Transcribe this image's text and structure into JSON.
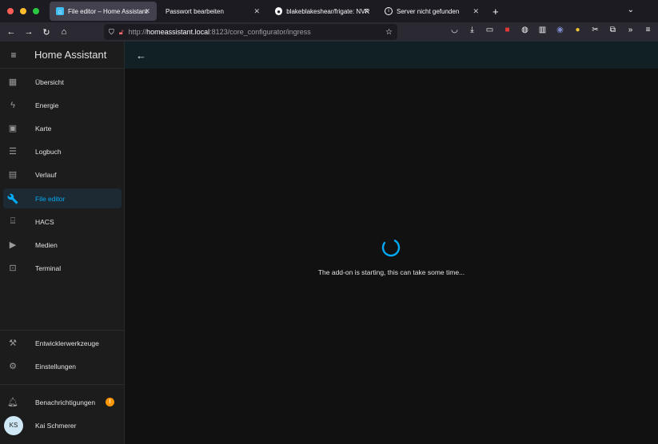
{
  "browser": {
    "tabs": [
      {
        "title": "File editor – Home Assistant",
        "favicon": "home-assistant-icon",
        "active": true
      },
      {
        "title": "Passwort bearbeiten",
        "favicon": "",
        "active": false
      },
      {
        "title": "blakeblakeshear/frigate: NVR w",
        "favicon": "github-icon",
        "active": false
      },
      {
        "title": "Server nicht gefunden",
        "favicon": "info-icon",
        "active": false
      }
    ],
    "url": {
      "scheme": "http://",
      "host": "homeassistant.local",
      "rest": ":8123/core_configurator/ingress"
    }
  },
  "sidebar": {
    "title": "Home Assistant",
    "items": [
      {
        "label": "Übersicht",
        "icon": "dashboard-icon",
        "active": false
      },
      {
        "label": "Energie",
        "icon": "lightning-icon",
        "active": false
      },
      {
        "label": "Karte",
        "icon": "map-person-icon",
        "active": false
      },
      {
        "label": "Logbuch",
        "icon": "list-icon",
        "active": false
      },
      {
        "label": "Verlauf",
        "icon": "chart-icon",
        "active": false
      },
      {
        "label": "File editor",
        "icon": "wrench-icon",
        "active": true
      },
      {
        "label": "HACS",
        "icon": "store-icon",
        "active": false
      },
      {
        "label": "Medien",
        "icon": "media-icon",
        "active": false
      },
      {
        "label": "Terminal",
        "icon": "terminal-icon",
        "active": false
      }
    ],
    "bottom_items": [
      {
        "label": "Entwicklerwerkzeuge",
        "icon": "hammer-icon"
      },
      {
        "label": "Einstellungen",
        "icon": "gear-icon"
      }
    ],
    "notifications": {
      "label": "Benachrichtigungen",
      "icon": "bell-icon",
      "count": "!"
    },
    "user": {
      "name": "Kai Schmerer",
      "initials": "KS"
    }
  },
  "main": {
    "status_text": "The add-on is starting, this can take some time...",
    "accent_color": "#03a9f4"
  }
}
